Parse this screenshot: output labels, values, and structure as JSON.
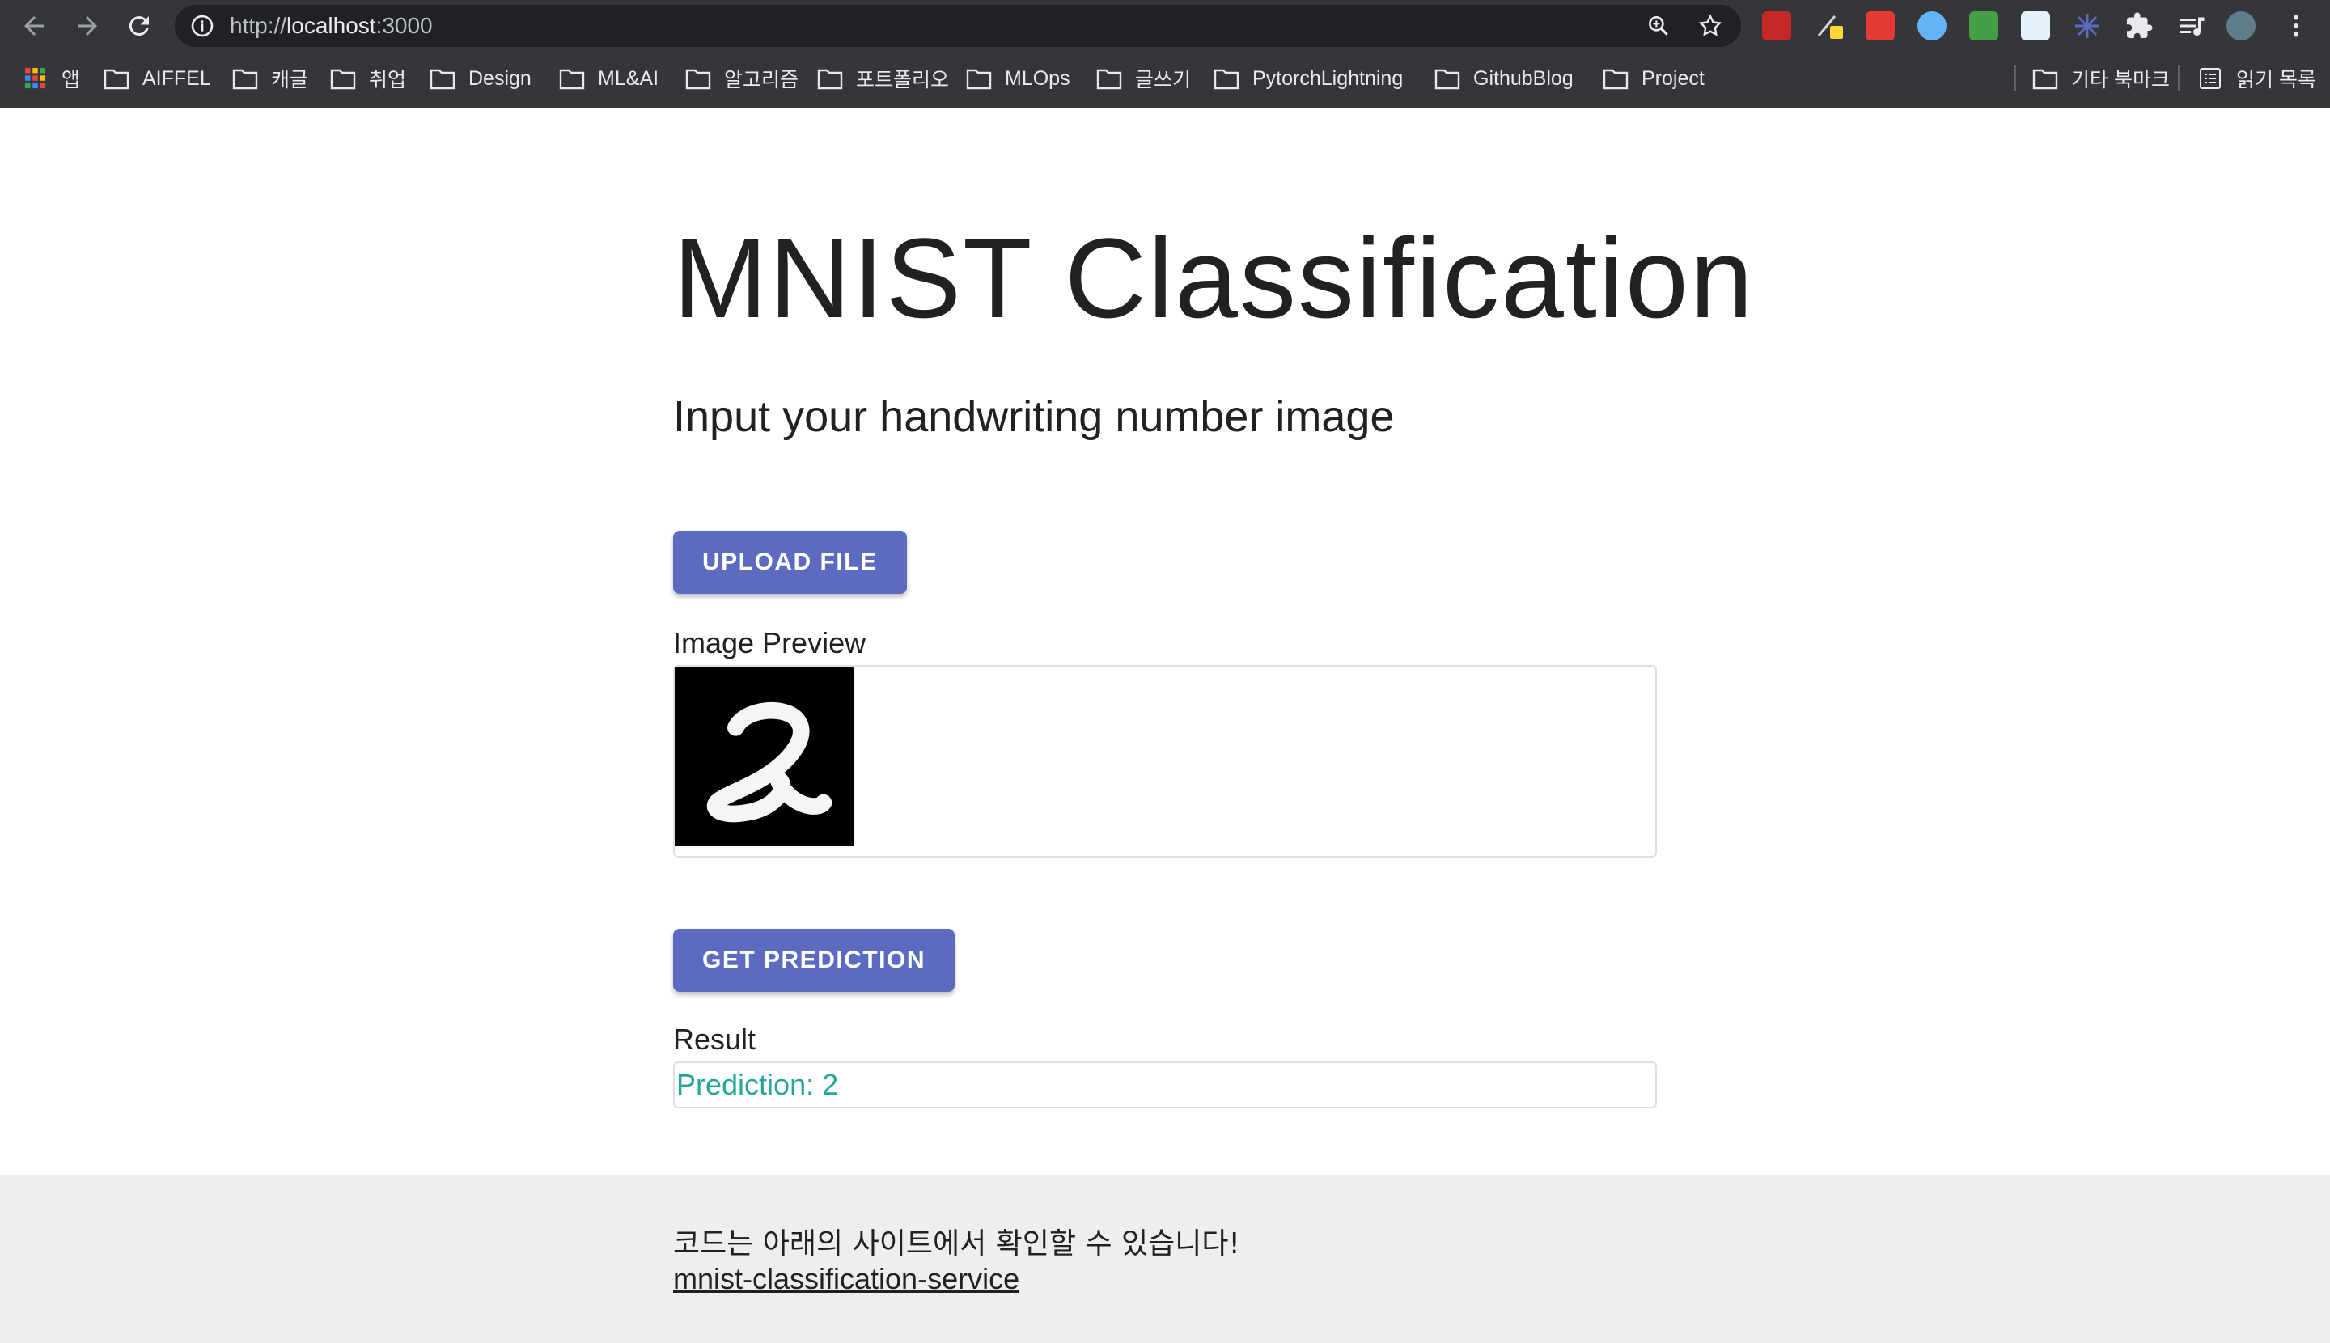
{
  "browser": {
    "url_scheme": "http://",
    "url_host": "localhost",
    "url_port": ":3000",
    "bookmarks": [
      {
        "label": "앱",
        "icon": "apps-grid-icon"
      },
      {
        "label": "AIFFEL",
        "icon": "folder-icon"
      },
      {
        "label": "캐글",
        "icon": "folder-icon"
      },
      {
        "label": "취업",
        "icon": "folder-icon"
      },
      {
        "label": "Design",
        "icon": "folder-icon"
      },
      {
        "label": "ML&AI",
        "icon": "folder-icon"
      },
      {
        "label": "알고리즘",
        "icon": "folder-icon"
      },
      {
        "label": "포트폴리오",
        "icon": "folder-icon"
      },
      {
        "label": "MLOps",
        "icon": "folder-icon"
      },
      {
        "label": "글쓰기",
        "icon": "folder-icon"
      },
      {
        "label": "PytorchLightning",
        "icon": "folder-icon"
      },
      {
        "label": "GithubBlog",
        "icon": "folder-icon"
      },
      {
        "label": "Project",
        "icon": "folder-icon"
      }
    ],
    "other_bookmarks": "기타 북마크",
    "reading_list": "읽기 목록"
  },
  "page": {
    "title": "MNIST Classification",
    "subtitle": "Input your handwriting number image",
    "upload_button": "UPLOAD FILE",
    "preview_label": "Image Preview",
    "predict_button": "GET PREDICTION",
    "result_label": "Result",
    "result_text": "Prediction: 2"
  },
  "footer": {
    "text": "코드는 아래의 사이트에서 확인할 수 있습니다!",
    "link": "mnist-classification-service"
  },
  "colors": {
    "accent": "#5c6bc0",
    "result": "#26a69a",
    "chrome": "#35363a",
    "footer_bg": "#eeeeee"
  }
}
